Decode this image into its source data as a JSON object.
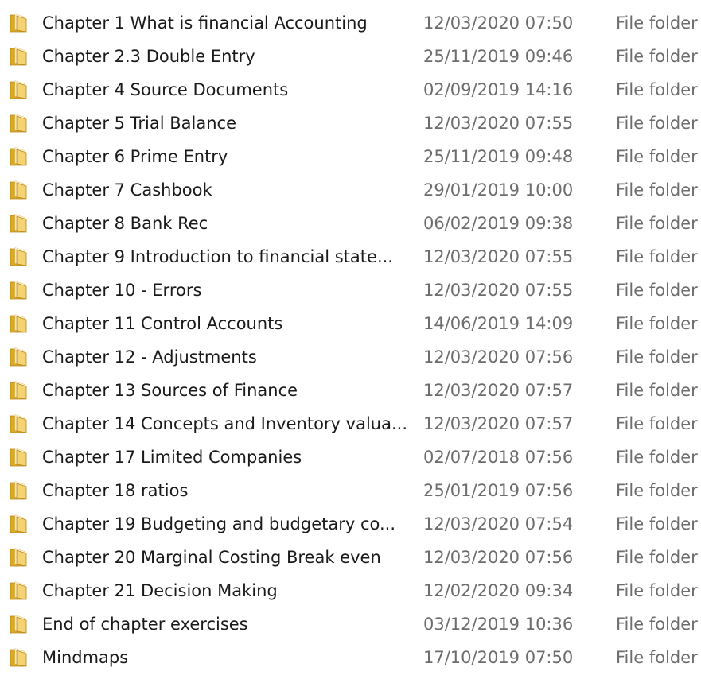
{
  "files": [
    {
      "name": "Chapter 1 What is financial Accounting",
      "date": "12/03/2020 07:50",
      "type": "File folder",
      "icon": "folder-icon"
    },
    {
      "name": "Chapter 2.3 Double Entry",
      "date": "25/11/2019 09:46",
      "type": "File folder",
      "icon": "folder-icon"
    },
    {
      "name": "Chapter 4 Source Documents",
      "date": "02/09/2019 14:16",
      "type": "File folder",
      "icon": "folder-icon"
    },
    {
      "name": "Chapter 5 Trial Balance",
      "date": "12/03/2020 07:55",
      "type": "File folder",
      "icon": "folder-icon"
    },
    {
      "name": "Chapter 6 Prime Entry",
      "date": "25/11/2019 09:48",
      "type": "File folder",
      "icon": "folder-icon"
    },
    {
      "name": "Chapter 7 Cashbook",
      "date": "29/01/2019 10:00",
      "type": "File folder",
      "icon": "folder-icon"
    },
    {
      "name": "Chapter 8 Bank Rec",
      "date": "06/02/2019 09:38",
      "type": "File folder",
      "icon": "folder-icon"
    },
    {
      "name": "Chapter 9 Introduction to financial state...",
      "date": "12/03/2020 07:55",
      "type": "File folder",
      "icon": "folder-icon"
    },
    {
      "name": "Chapter 10 - Errors",
      "date": "12/03/2020 07:55",
      "type": "File folder",
      "icon": "folder-icon"
    },
    {
      "name": "Chapter 11 Control Accounts",
      "date": "14/06/2019 14:09",
      "type": "File folder",
      "icon": "folder-icon"
    },
    {
      "name": "Chapter 12 - Adjustments",
      "date": "12/03/2020 07:56",
      "type": "File folder",
      "icon": "folder-icon"
    },
    {
      "name": "Chapter 13 Sources of Finance",
      "date": "12/03/2020 07:57",
      "type": "File folder",
      "icon": "folder-icon"
    },
    {
      "name": "Chapter 14 Concepts and Inventory valua...",
      "date": "12/03/2020 07:57",
      "type": "File folder",
      "icon": "folder-icon"
    },
    {
      "name": "Chapter 17 Limited Companies",
      "date": "02/07/2018 07:56",
      "type": "File folder",
      "icon": "folder-icon"
    },
    {
      "name": "Chapter 18 ratios",
      "date": "25/01/2019 07:56",
      "type": "File folder",
      "icon": "folder-icon"
    },
    {
      "name": "Chapter 19 Budgeting and budgetary co...",
      "date": "12/03/2020 07:54",
      "type": "File folder",
      "icon": "folder-icon"
    },
    {
      "name": "Chapter 20 Marginal Costing Break even",
      "date": "12/03/2020 07:56",
      "type": "File folder",
      "icon": "folder-icon"
    },
    {
      "name": "Chapter 21 Decision Making",
      "date": "12/02/2020 09:34",
      "type": "File folder",
      "icon": "folder-icon"
    },
    {
      "name": "End of chapter exercises",
      "date": "03/12/2019 10:36",
      "type": "File folder",
      "icon": "folder-icon"
    },
    {
      "name": "Mindmaps",
      "date": "17/10/2019 07:50",
      "type": "File folder",
      "icon": "folder-icon"
    }
  ],
  "colors": {
    "folder_back": "#d9a928",
    "folder_front": "#f5d272",
    "folder_edge": "#b8861a",
    "name_text": "#1a1a1a",
    "meta_text": "#6d6d6d"
  }
}
